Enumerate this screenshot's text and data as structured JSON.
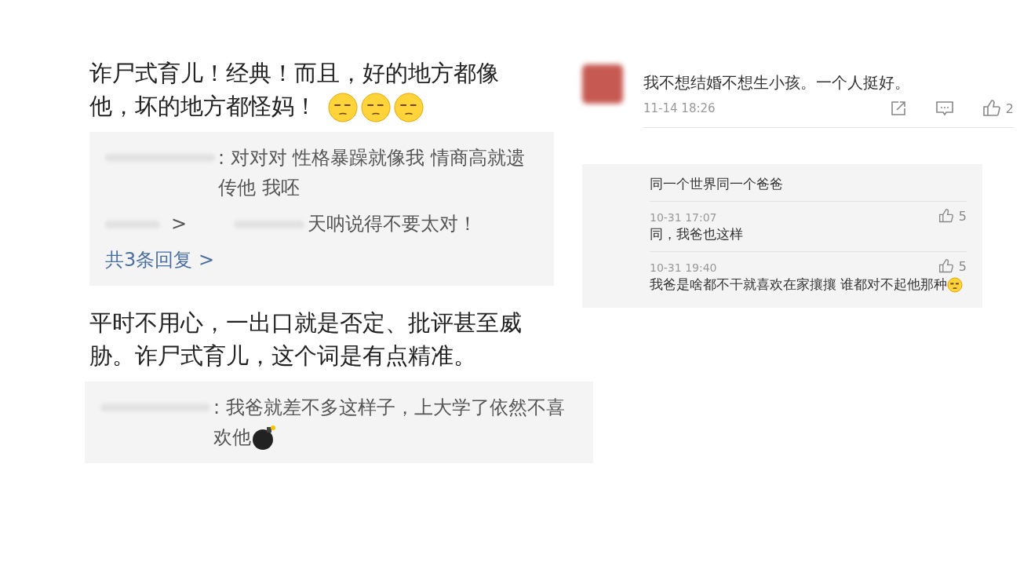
{
  "left_posts": [
    {
      "text": "诈尸式育儿！经典！而且，好的地方都像他，坏的地方都怪妈！",
      "emoji": true,
      "replies": [
        {
          "kind": "reply",
          "text": ": 对对对 性格暴躁就像我 情商高就遗传他 我呸"
        },
        {
          "kind": "reply",
          "arrow": ">",
          "text": "天呐说得不要太对！"
        },
        {
          "kind": "more",
          "text": "共3条回复 >"
        }
      ]
    },
    {
      "text": "平时不用心，一出口就是否定、批评甚至威胁。诈尸式育儿，这个词是有点精准。",
      "emoji": false,
      "replies": [
        {
          "kind": "reply",
          "text": ": 我爸就差不多这样子，上大学了依然不喜欢他",
          "bomb": true
        }
      ]
    }
  ],
  "right_comment": {
    "text": "我不想结婚不想生小孩。一个人挺好。",
    "time": "11-14 18:26",
    "likes": "2",
    "replies": [
      {
        "text": "同一个世界同一个爸爸"
      },
      {
        "time": "10-31 17:07",
        "likes": "5",
        "text": "同，我爸也这样"
      },
      {
        "time": "10-31 19:40",
        "likes": "5",
        "text": "我爸是啥都不干就喜欢在家攘攘 谁都对不起他那种",
        "emoji": true
      }
    ]
  }
}
